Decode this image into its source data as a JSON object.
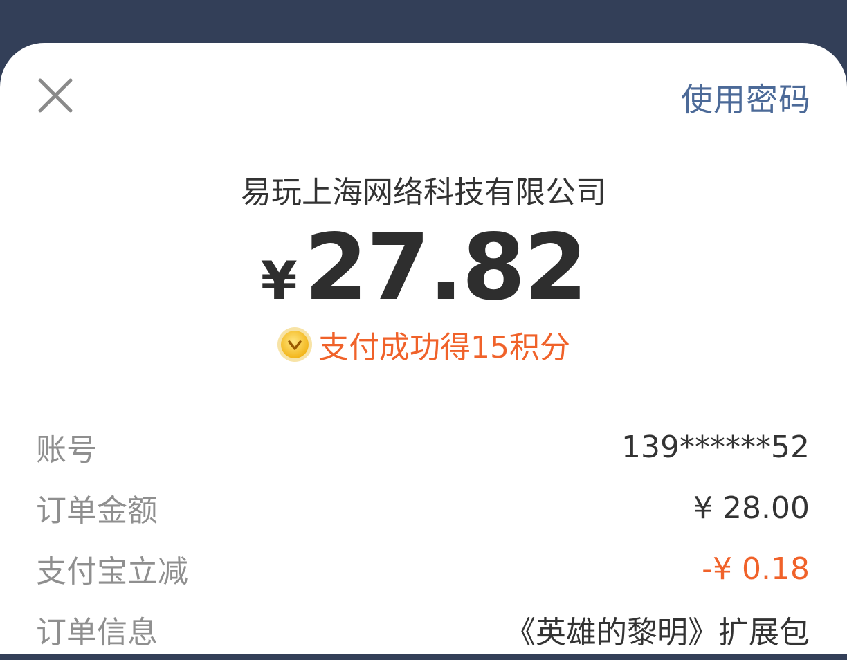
{
  "header": {
    "close_icon": "close-icon",
    "use_password_label": "使用密码"
  },
  "payment": {
    "merchant": "易玩上海网络科技有限公司",
    "currency_symbol": "¥",
    "amount": "27.82",
    "reward_icon": "vip-coin-icon",
    "reward_text": "支付成功得15积分"
  },
  "details": [
    {
      "label": "账号",
      "value": "139******52"
    },
    {
      "label": "订单金额",
      "value": "¥ 28.00"
    },
    {
      "label": "支付宝立减",
      "value": "-¥ 0.18"
    },
    {
      "label": "订单信息",
      "value": "《英雄的黎明》扩展包"
    }
  ],
  "colors": {
    "backdrop": "#333f58",
    "sheet": "#ffffff",
    "link": "#4c6a98",
    "accent_orange": "#f0622a",
    "label_gray": "#8f8f8f",
    "text_dark": "#333333"
  }
}
